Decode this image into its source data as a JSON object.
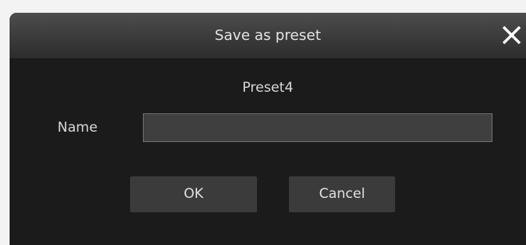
{
  "dialog": {
    "title": "Save as preset",
    "close_icon": "close-icon",
    "preset_name": "Preset4",
    "name_label": "Name",
    "name_value": "",
    "ok_label": "OK",
    "cancel_label": "Cancel"
  },
  "colors": {
    "background": "#1b1b1b",
    "titlebar": "#3c3c3c",
    "input": "#3f3f3f",
    "button": "#3b3b3b",
    "text": "#d9d9d9"
  }
}
